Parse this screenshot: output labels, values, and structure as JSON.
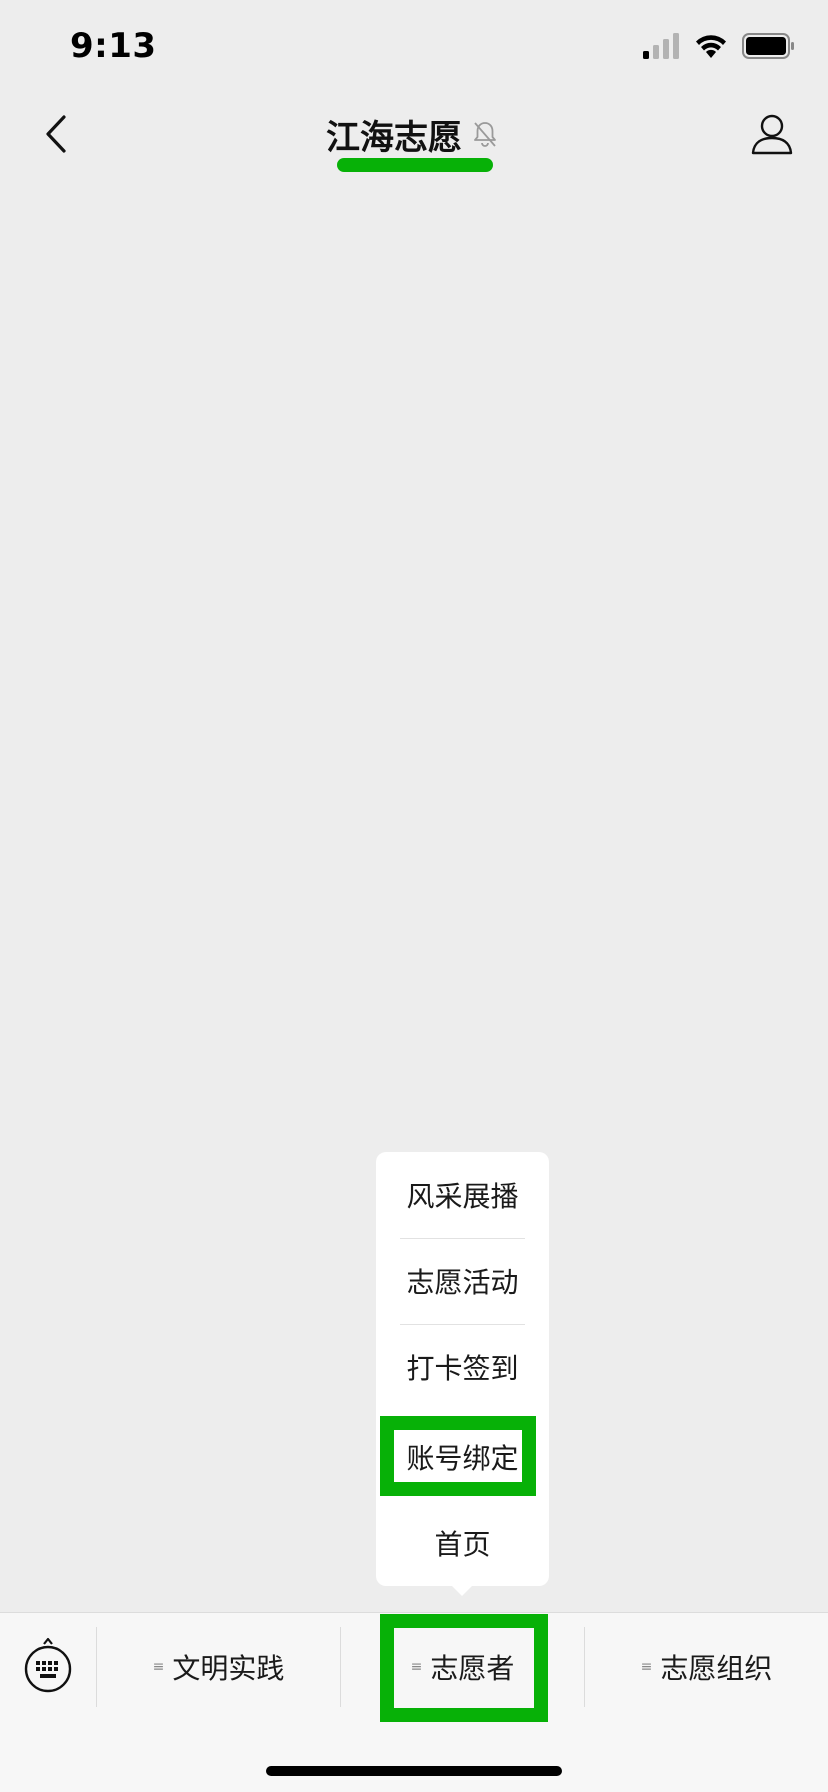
{
  "status_bar": {
    "time": "9:13",
    "icons": [
      "cellular-signal-icon",
      "wifi-icon",
      "battery-icon"
    ]
  },
  "nav": {
    "title": "江海志愿",
    "icons": [
      "back-chevron-icon",
      "mute-bell-icon",
      "profile-icon"
    ]
  },
  "popup_menu": {
    "items": [
      {
        "label": "风采展播"
      },
      {
        "label": "志愿活动"
      },
      {
        "label": "打卡签到"
      },
      {
        "label": "账号绑定"
      },
      {
        "label": "首页"
      }
    ],
    "highlighted_item": "账号绑定"
  },
  "bottom_menu": {
    "keyboard_icon": "keyboard-icon",
    "submenu_glyph": "≡",
    "tabs": [
      {
        "label": "文明实践"
      },
      {
        "label": "志愿者"
      },
      {
        "label": "志愿组织"
      }
    ],
    "highlighted_tab": "志愿者"
  },
  "colors": {
    "background": "#EDEDED",
    "highlight": "#07B107",
    "bottom_bar": "#F7F7F7",
    "popup": "#FFFFFF"
  }
}
